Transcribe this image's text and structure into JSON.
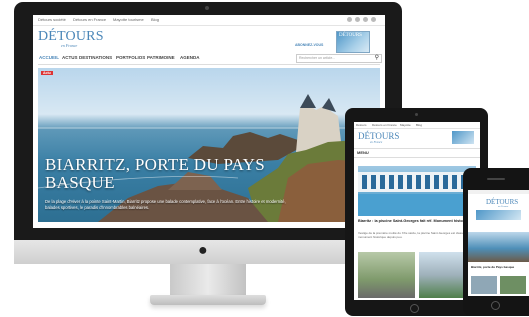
{
  "site": {
    "topbar_links": [
      "Détours société",
      "Détours en France",
      "Mayotte tourisme",
      "Blog"
    ],
    "logo": "DÉTOURS",
    "logo_sub": "en France",
    "promo_label": "ABONNEZ-VOUS",
    "magazine_label": "DÉTOURS",
    "nav": [
      "ACCUEIL",
      "ACTUS",
      "DESTINATIONS",
      "PORTFOLIOS",
      "PATRIMOINE",
      "AGENDA"
    ],
    "search_placeholder": "Rechercher un article...",
    "accent_color": "#4a86b8"
  },
  "hero": {
    "tag": "Actu",
    "title_line1": "BIARRITZ, PORTE DU PAYS",
    "title_line2": "BASQUE",
    "text": "De la plage d'Hiver à la pointe Saint-Martin, Biarritz propose une balade contemplative, face à l'océan. Entre histoire et modernité, balades sportives, le paradis d'innombrables balnéaires."
  },
  "tablet": {
    "topbar_links": [
      "Détours",
      "Détours en France",
      "Mayotte",
      "Blog"
    ],
    "logo": "DÉTOURS",
    "logo_sub": "en France",
    "menu_label": "MENU",
    "article_title": "Biarritz : la piscine Saint-Georges fait réf. Monument historique",
    "article_text": "Vestige de la première moitié du XXe siècle, la piscine Saint-Georges est classée monument historique depuis peu."
  },
  "phone": {
    "logo": "DÉTOURS",
    "logo_sub": "en France",
    "article_title": "Biarritz, porte du Pays basque"
  }
}
